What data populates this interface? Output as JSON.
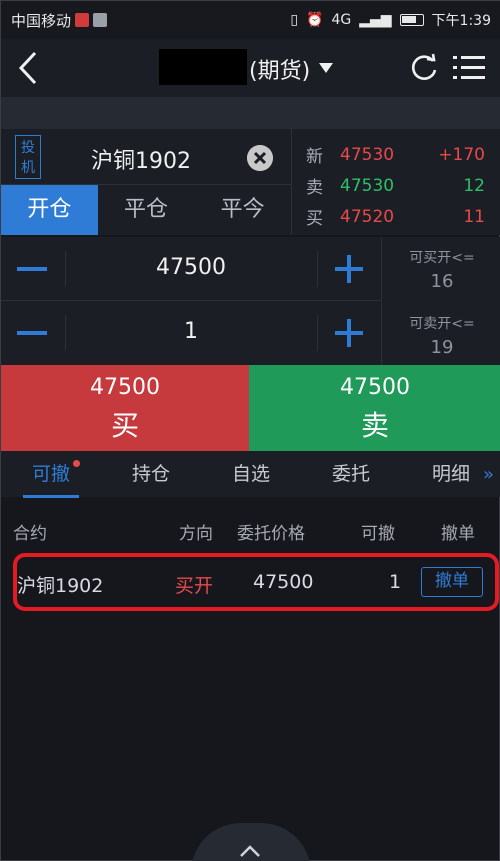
{
  "status_bar": {
    "carrier": "中国移动",
    "network": "4G",
    "time": "下午1:39"
  },
  "nav": {
    "title": "(期货)"
  },
  "contract": {
    "type_label": "投机",
    "name": "沪铜1902"
  },
  "trade_tabs": [
    "开仓",
    "平仓",
    "平今"
  ],
  "quotes": [
    {
      "label": "新",
      "price": "47530",
      "change": "+170",
      "price_color": "#e84a4a",
      "change_color": "#e84a4a"
    },
    {
      "label": "卖",
      "price": "47530",
      "change": "12",
      "price_color": "#2fbf6a",
      "change_color": "#2fbf6a"
    },
    {
      "label": "买",
      "price": "47520",
      "change": "11",
      "price_color": "#e84a4a",
      "change_color": "#e84a4a"
    }
  ],
  "price_stepper": {
    "value": "47500"
  },
  "qty_stepper": {
    "value": "1"
  },
  "available": {
    "buy_open_label": "可买开<=",
    "buy_open_value": "16",
    "sell_open_label": "可卖开<=",
    "sell_open_value": "19"
  },
  "buy": {
    "price": "47500",
    "label": "买"
  },
  "sell": {
    "price": "47500",
    "label": "卖"
  },
  "bottom_tabs": [
    "可撤",
    "持仓",
    "自选",
    "委托",
    "明细"
  ],
  "table": {
    "headers": [
      "合约",
      "方向",
      "委托价格",
      "可撤",
      "撤单"
    ],
    "rows": [
      {
        "contract": "沪铜1902",
        "direction": "买开",
        "price": "47500",
        "qty": "1",
        "action": "撤单"
      }
    ]
  },
  "colors": {
    "accent": "#2f7cd6",
    "buy": "#c6393d",
    "sell": "#1f9a58",
    "highlight": "#e51b24"
  }
}
